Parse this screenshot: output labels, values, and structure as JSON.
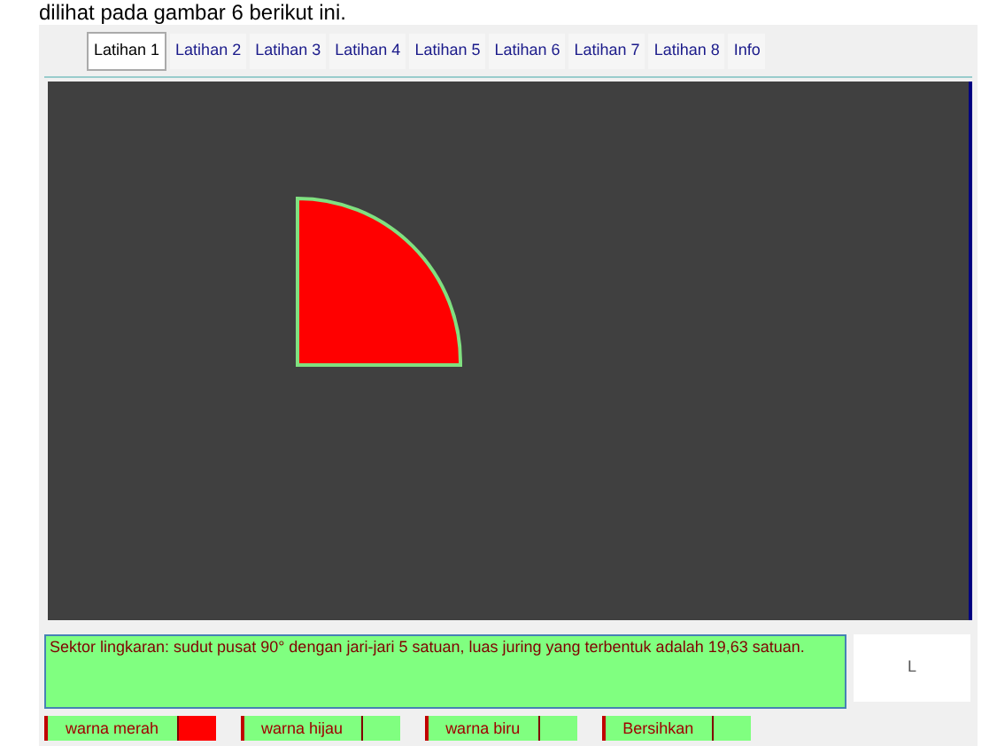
{
  "caption": "dilihat pada gambar 6 berikut ini.",
  "tabs": [
    {
      "label": "Latihan 1",
      "selected": true
    },
    {
      "label": "Latihan 2",
      "selected": false
    },
    {
      "label": "Latihan 3",
      "selected": false
    },
    {
      "label": "Latihan 4",
      "selected": false
    },
    {
      "label": "Latihan 5",
      "selected": false
    },
    {
      "label": "Latihan 6",
      "selected": false
    },
    {
      "label": "Latihan 7",
      "selected": false
    },
    {
      "label": "Latihan 8",
      "selected": false
    },
    {
      "label": "Info",
      "selected": false
    }
  ],
  "status": {
    "text": "Sektor lingkaran: sudut pusat 90° dengan jari-jari 5 satuan, luas juring yang terbentuk adalah 19,63 satuan.",
    "side": "L"
  },
  "buttons": [
    {
      "label": "warna merah",
      "color": "#ff0000"
    },
    {
      "label": "warna hijau",
      "color": "#80ff80"
    },
    {
      "label": "warna biru",
      "color": "#80ff80"
    },
    {
      "label": "Bersihkan",
      "color": "#80ff80"
    }
  ]
}
